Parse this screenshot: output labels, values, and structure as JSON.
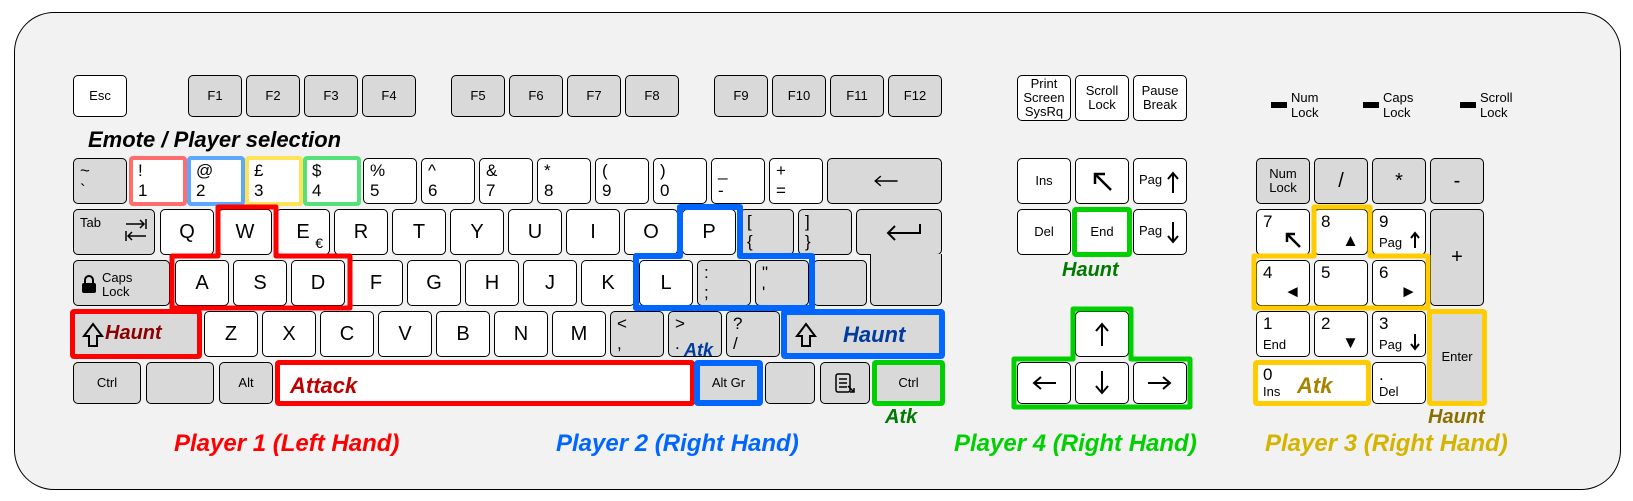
{
  "title_emote": "Emote / Player selection",
  "players": {
    "p1": {
      "label": "Player 1 (Left Hand)",
      "color": "#ff0000"
    },
    "p2": {
      "label": "Player 2 (Right Hand)",
      "color": "#0066ff"
    },
    "p3": {
      "label": "Player 3 (Right Hand)",
      "color": "#d4b400"
    },
    "p4": {
      "label": "Player 4 (Right Hand)",
      "color": "#00d000"
    }
  },
  "actions": {
    "haunt_p1": "Haunt",
    "haunt_p2": "Haunt",
    "haunt_p3": "Haunt",
    "haunt_p4": "Haunt",
    "attack_p1": "Attack",
    "atk_p2": "Atk",
    "atk_p3": "Atk",
    "atk_p4": "Atk"
  },
  "row_f": {
    "esc": "Esc",
    "f": [
      "F1",
      "F2",
      "F3",
      "F4",
      "F5",
      "F6",
      "F7",
      "F8",
      "F9",
      "F10",
      "F11",
      "F12"
    ]
  },
  "row_num": [
    {
      "t": "~",
      "b": "`"
    },
    {
      "t": "!",
      "b": "1"
    },
    {
      "t": "@",
      "b": "2"
    },
    {
      "t": "£",
      "b": "3"
    },
    {
      "t": "$",
      "b": "4"
    },
    {
      "t": "%",
      "b": "5"
    },
    {
      "t": "^",
      "b": "6"
    },
    {
      "t": "&",
      "b": "7"
    },
    {
      "t": "*",
      "b": "8"
    },
    {
      "t": "(",
      "b": "9"
    },
    {
      "t": ")",
      "b": "0"
    },
    {
      "t": "_",
      "b": "-"
    },
    {
      "t": "+",
      "b": "="
    }
  ],
  "row_q": {
    "tab": "Tab",
    "keys": [
      "Q",
      "W",
      "E",
      "R",
      "T",
      "Y",
      "U",
      "I",
      "O",
      "P"
    ],
    "br1": {
      "t": "[",
      "b": "{"
    },
    "br2": {
      "t": "]",
      "b": "}"
    },
    "e_sub": "€"
  },
  "row_a": {
    "caps": "Caps\nLock",
    "keys": [
      "A",
      "S",
      "D",
      "F",
      "G",
      "H",
      "J",
      "K",
      "L"
    ],
    "sc": {
      "t": ":",
      "b": ";"
    },
    "qt": {
      "t": "\"",
      "b": "'"
    }
  },
  "row_z": {
    "keys": [
      "Z",
      "X",
      "C",
      "V",
      "B",
      "N",
      "M"
    ],
    "cm": {
      "t": "<",
      "b": ","
    },
    "pd": {
      "t": ">",
      "b": "."
    },
    "sl": {
      "t": "?",
      "b": "/"
    }
  },
  "row_ctrl": {
    "ctrl_l": "Ctrl",
    "alt": "Alt",
    "altgr": "Alt Gr",
    "ctrl_r": "Ctrl"
  },
  "sys": {
    "prtsc": "Print\nScreen\nSysRq",
    "scrlk": "Scroll\nLock",
    "pause": "Pause\nBreak",
    "ins": "Ins",
    "home": "",
    "pgup": "Pag",
    "del": "Del",
    "end": "End",
    "pgdn": "Pag"
  },
  "numpad": {
    "numlk": "Num\nLock",
    "slash": "/",
    "star": "*",
    "minus": "-",
    "plus": "+",
    "enter": "Enter",
    "k7": "7",
    "k8": "8",
    "k9": "9",
    "k9s": "Pag",
    "k4": "4",
    "k5": "5",
    "k6": "6",
    "k1": "1",
    "k1s": "End",
    "k2": "2",
    "k3": "3",
    "k3s": "Pag",
    "k0": "0",
    "k0s": "Ins",
    "kd": ".",
    "kds": "Del"
  },
  "locks": {
    "num": "Num\nLock",
    "caps": "Caps\nLock",
    "scroll": "Scroll\nLock"
  },
  "emote_colors": {
    "k1": "#ff6d6d",
    "k2": "#5da8ff",
    "k3": "#ffe457",
    "k4": "#55e07a"
  }
}
